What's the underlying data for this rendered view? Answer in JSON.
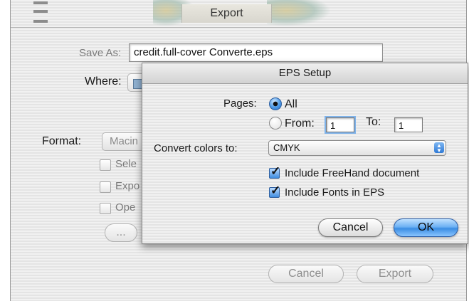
{
  "export_window": {
    "title": "Export",
    "save_as_label": "Save As:",
    "save_as_value": "credit.full-cover Converte.eps",
    "where_label": "Where:",
    "format_label": "Format:",
    "format_value": "Macin",
    "option_select": "Sele",
    "option_export": "Expo",
    "option_open": "Ope",
    "ellipsis_button": "...",
    "cancel_button": "Cancel",
    "export_button": "Export"
  },
  "eps_setup": {
    "title": "EPS Setup",
    "pages_label": "Pages:",
    "pages_all_label": "All",
    "pages_from_label": "From:",
    "pages_from_value": "1",
    "pages_to_label": "To:",
    "pages_to_value": "1",
    "pages_selected": "All",
    "convert_colors_label": "Convert colors to:",
    "convert_colors_value": "CMYK",
    "include_freehand_label": "Include FreeHand document",
    "include_freehand_checked": true,
    "include_fonts_label": "Include Fonts in EPS",
    "include_fonts_checked": true,
    "cancel_button": "Cancel",
    "ok_button": "OK"
  },
  "colors": {
    "default_button": "#4c9ae8",
    "dimmed_text": "#8a8a8a"
  }
}
